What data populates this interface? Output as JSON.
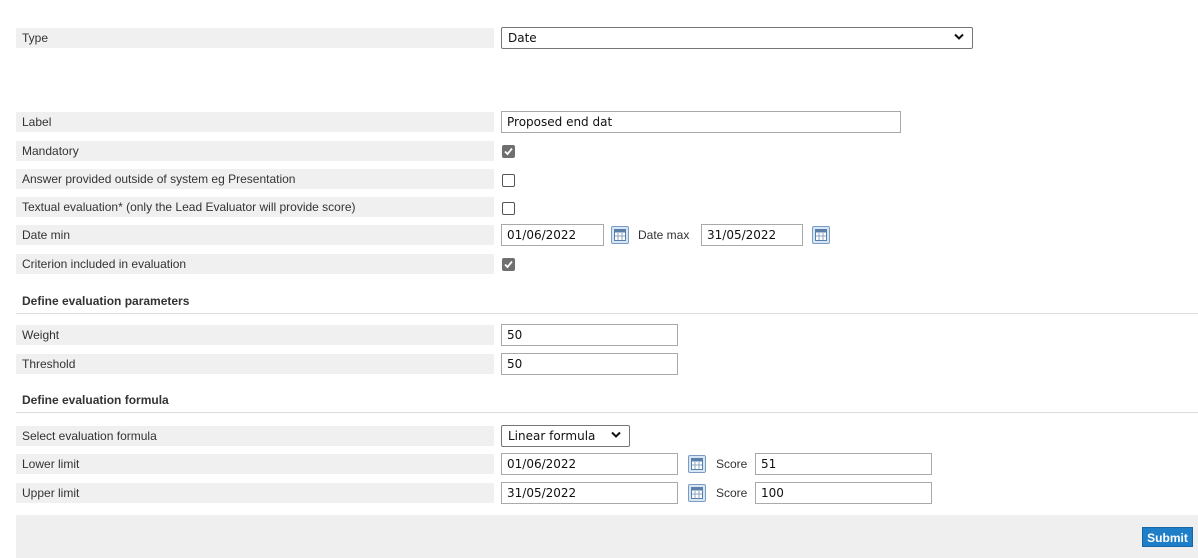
{
  "form": {
    "type": {
      "label": "Type",
      "value": "Date"
    },
    "label": {
      "label": "Label",
      "value": "Proposed end dat"
    },
    "mandatory": {
      "label": "Mandatory",
      "checked": true
    },
    "outside": {
      "label": "Answer provided outside of system eg Presentation",
      "checked": false
    },
    "textual": {
      "label": "Textual evaluation* (only the Lead Evaluator will provide score)",
      "checked": false
    },
    "date_min": {
      "label": "Date min",
      "value": "01/06/2022",
      "max_label": "Date max",
      "max_value": "31/05/2022"
    },
    "criterion": {
      "label": "Criterion included in evaluation",
      "checked": true
    }
  },
  "params": {
    "heading": "Define evaluation parameters",
    "weight": {
      "label": "Weight",
      "value": "50"
    },
    "threshold": {
      "label": "Threshold",
      "value": "50"
    }
  },
  "formula": {
    "heading": "Define evaluation formula",
    "select": {
      "label": "Select evaluation formula",
      "value": "Linear formula"
    },
    "lower": {
      "label": "Lower limit",
      "date": "01/06/2022",
      "score_label": "Score",
      "score": "51"
    },
    "upper": {
      "label": "Upper limit",
      "date": "31/05/2022",
      "score_label": "Score",
      "score": "100"
    }
  },
  "submit_label": "Submit",
  "icons": {
    "calendar": "calendar-icon",
    "chevron": "chevron-down-icon",
    "check": "checkbox-check"
  },
  "colors": {
    "accent": "#1e7ec8",
    "label_bg": "#f0f0f0"
  }
}
